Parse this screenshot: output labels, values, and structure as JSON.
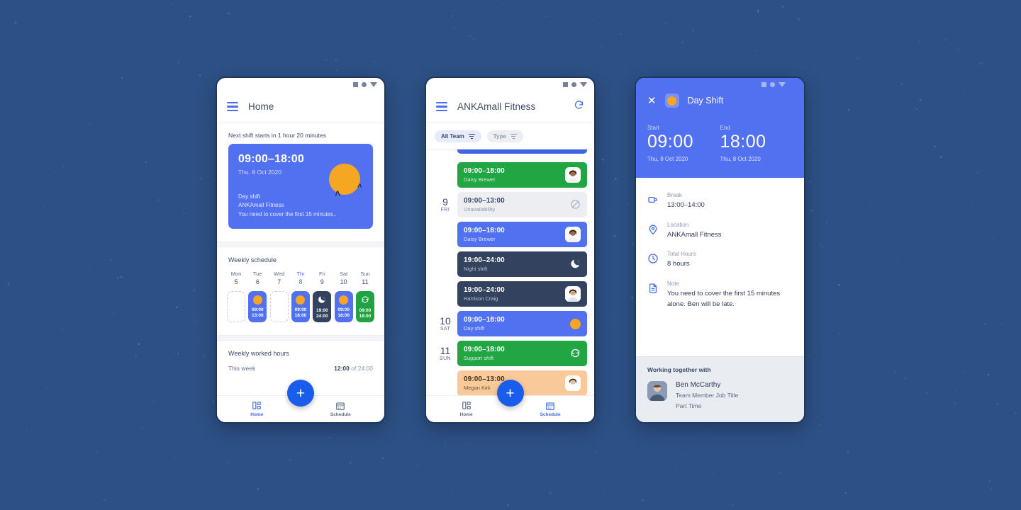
{
  "background": {
    "color": "#2d5186"
  },
  "status_bar": {
    "icons": [
      "square-icon",
      "circle-icon",
      "triangle-down-icon"
    ]
  },
  "phone1": {
    "appbar": {
      "menu_icon": "hamburger-icon",
      "title": "Home"
    },
    "next_shift_label": "Next shift starts in 1 hour 20 minutes",
    "hero": {
      "time": "09:00–18:00",
      "date": "Thu, 8 Oct 2020",
      "shift_type": "Day shift",
      "location": "ANKAmall Fitness",
      "note": "You need to cover the first 15 minutes..",
      "icon": "sun-icon",
      "color": "#5271f0"
    },
    "weekly_schedule": {
      "title": "Weekly schedule",
      "days": [
        {
          "name": "Mon",
          "num": "5",
          "active": false,
          "state": "empty",
          "icon": "",
          "start": "",
          "end": ""
        },
        {
          "name": "Tue",
          "num": "6",
          "active": false,
          "state": "blue",
          "icon": "sun-icon",
          "start": "09:00",
          "end": "13:00"
        },
        {
          "name": "Wed",
          "num": "7",
          "active": false,
          "state": "empty",
          "icon": "",
          "start": "",
          "end": ""
        },
        {
          "name": "Thr",
          "num": "8",
          "active": true,
          "state": "blue",
          "icon": "sun-icon",
          "start": "09:00",
          "end": "18:00"
        },
        {
          "name": "Fri",
          "num": "9",
          "active": false,
          "state": "night",
          "icon": "moon-icon",
          "start": "19:00",
          "end": "24:00"
        },
        {
          "name": "Sat",
          "num": "10",
          "active": false,
          "state": "blue",
          "icon": "sun-icon",
          "start": "09:00",
          "end": "18:00"
        },
        {
          "name": "Sun",
          "num": "11",
          "active": false,
          "state": "green",
          "icon": "refresh-icon",
          "start": "09:00",
          "end": "18:00"
        }
      ]
    },
    "worked": {
      "title": "Weekly worked hours",
      "row_label": "This week",
      "value": "12:00",
      "of": "of 24:00"
    },
    "nav": {
      "fab_label": "+",
      "home_label": "Home",
      "schedule_label": "Schedule",
      "active": "Home"
    }
  },
  "phone2": {
    "appbar": {
      "menu_icon": "hamburger-icon",
      "title": "ANKAmall Fitness",
      "refresh_icon": "refresh-icon"
    },
    "filters": [
      {
        "label": "All Team",
        "style": "primary",
        "icon": "filter-icon"
      },
      {
        "label": "Type",
        "style": "plain",
        "icon": "filter-icon"
      }
    ],
    "days": [
      {
        "num": "",
        "dow": "",
        "shifts": [
          {
            "time": "09:00–18:00",
            "sub": "Daisy Brewer",
            "style": "green",
            "icon": "avatar",
            "avatar": "daisy"
          }
        ]
      },
      {
        "num": "9",
        "dow": "FRI",
        "shifts": [
          {
            "time": "09:00–13:00",
            "sub": "Unavailability",
            "style": "gray",
            "icon": "no-entry-icon"
          },
          {
            "time": "09:00–18:00",
            "sub": "Daisy Brewer",
            "style": "blue",
            "icon": "avatar",
            "avatar": "daisy"
          },
          {
            "time": "19:00–24:00",
            "sub": "Night shift",
            "style": "night",
            "icon": "moon-icon"
          },
          {
            "time": "19:00–24:00",
            "sub": "Harrison Craig",
            "style": "night",
            "icon": "avatar",
            "avatar": "harrison"
          }
        ]
      },
      {
        "num": "10",
        "dow": "SAT",
        "shifts": [
          {
            "time": "09:00–18:00",
            "sub": "Day shift",
            "style": "blue",
            "icon": "sun-icon"
          }
        ]
      },
      {
        "num": "11",
        "dow": "SUN",
        "shifts": [
          {
            "time": "09:00–18:00",
            "sub": "Support shift",
            "style": "green",
            "icon": "refresh-icon"
          },
          {
            "time": "09:00–13:00",
            "sub": "Megan Kirk",
            "style": "orange",
            "icon": "avatar",
            "avatar": "megan"
          }
        ]
      }
    ],
    "nav": {
      "fab_label": "+",
      "home_label": "Home",
      "schedule_label": "Schedule",
      "active": "Schedule"
    }
  },
  "phone3": {
    "header": {
      "close_icon": "close-icon",
      "shift_icon": "sun-icon",
      "title": "Day Shift",
      "start_label": "Start",
      "start_time": "09:00",
      "start_date": "Thu, 8 Oct 2020",
      "end_label": "End",
      "end_time": "18:00",
      "end_date": "Thu, 8 Oct 2020",
      "color": "#5271f0"
    },
    "info": [
      {
        "icon": "coffee-cup-icon",
        "label": "Break",
        "value": "13:00–14:00"
      },
      {
        "icon": "location-pin-icon",
        "label": "Location",
        "value": "ANKAmall Fitness"
      },
      {
        "icon": "clock-icon",
        "label": "Total Hours",
        "value": "8 hours"
      },
      {
        "icon": "document-icon",
        "label": "Note",
        "value": "You need to cover the first 15 minutes alone. Ben will be late."
      }
    ],
    "together": {
      "title": "Working together with",
      "person": {
        "name": "Ben McCarthy",
        "job_title": "Team Member Job Title",
        "employment": "Part Time"
      }
    }
  }
}
